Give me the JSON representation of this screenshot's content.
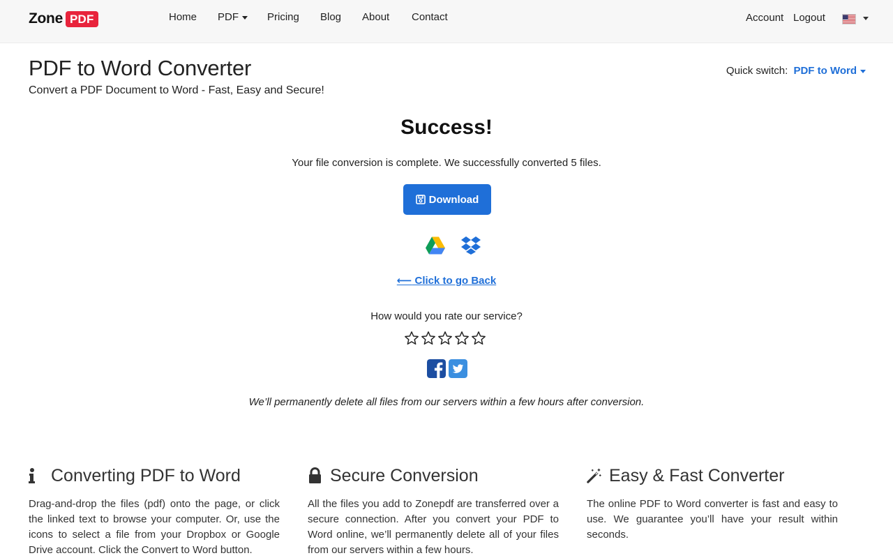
{
  "nav": {
    "logo_zone": "Zone",
    "logo_pdf": "PDF",
    "links": [
      {
        "label": "Home"
      },
      {
        "label": "PDF"
      },
      {
        "label": "Pricing"
      },
      {
        "label": "Blog"
      },
      {
        "label": "About"
      },
      {
        "label": "Contact"
      }
    ],
    "account": "Account",
    "logout": "Logout",
    "language_flag_icon": "us-flag-icon"
  },
  "header": {
    "title": "PDF to Word Converter",
    "subtitle": "Convert a PDF Document to Word - Fast, Easy and Secure!",
    "quick_switch_label": "Quick switch:",
    "quick_switch_value": "PDF to Word"
  },
  "result": {
    "title": "Success!",
    "message": "Your file conversion is complete. We successfully converted 5 files.",
    "download_label": "Download",
    "back_label": "Click to go Back",
    "rate_question": "How would you rate our service?",
    "rating_selected": 0,
    "rating_max": 5,
    "privacy_note": "We’ll permanently delete all files from our servers within a few hours after conversion."
  },
  "features": [
    {
      "icon": "info-icon",
      "title": "Converting PDF to Word",
      "text": "Drag-and-drop the files (pdf) onto the page, or click the linked text to browse your computer. Or, use the icons to select a file from your Dropbox or Google Drive account. Click the Convert to Word button."
    },
    {
      "icon": "lock-icon",
      "title": "Secure Conversion",
      "text": "All the files you add to Zonepdf are transferred over a secure connection. After you convert your PDF to Word online, we’ll permanently delete all of your files from our servers within a few hours."
    },
    {
      "icon": "magic-wand-icon",
      "title": "Easy & Fast Converter",
      "text": "The online PDF to Word converter is fast and easy to use. We guarantee you’ll have your result within seconds."
    }
  ],
  "colors": {
    "accent": "#1f6fd8",
    "brand_red": "#e8243c",
    "facebook": "#1c4ea1",
    "twitter": "#3b8fe0"
  }
}
